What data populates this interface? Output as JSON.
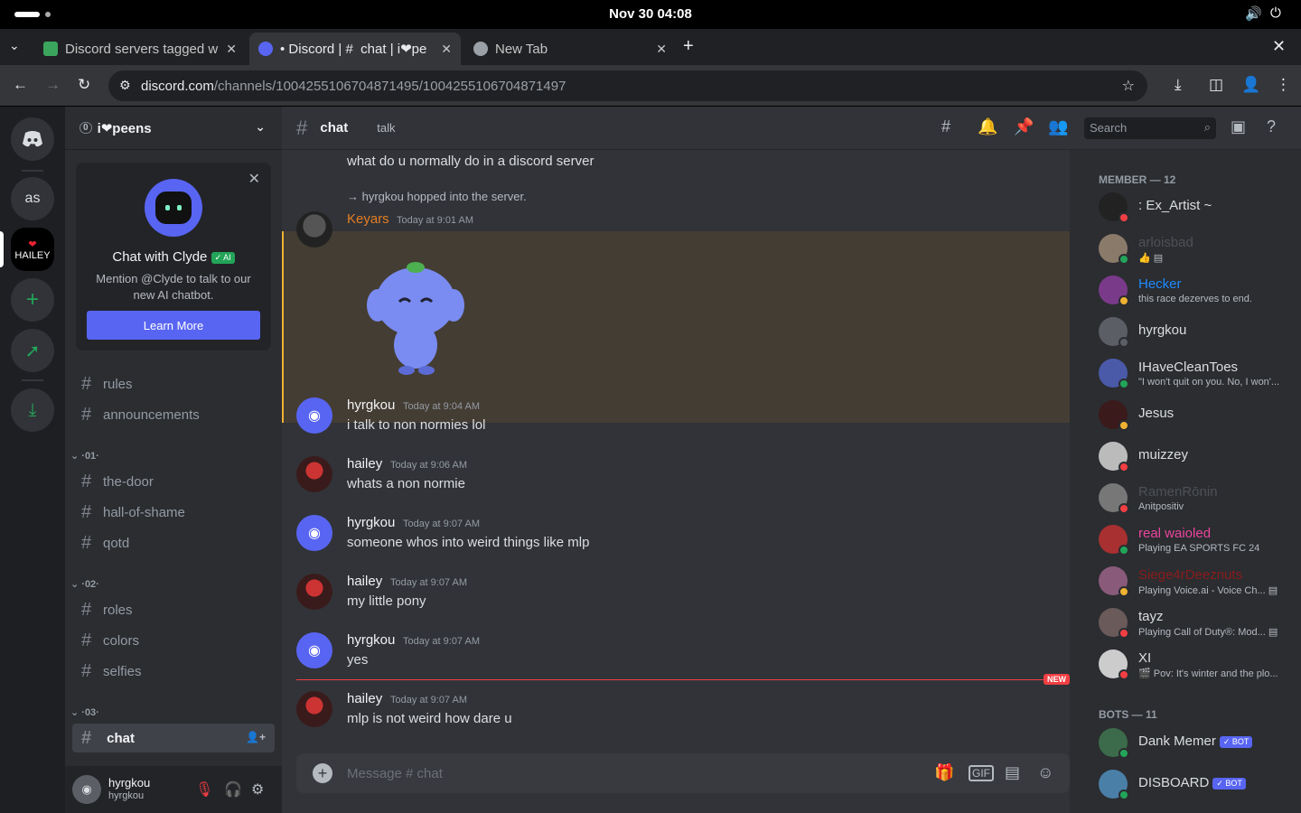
{
  "system": {
    "clock": "Nov 30  04:08"
  },
  "browser": {
    "tabs": [
      {
        "title": "Discord servers tagged w",
        "active": false
      },
      {
        "title": "• Discord | #  chat | i❤pe",
        "active": true
      },
      {
        "title": "New Tab",
        "active": false
      }
    ],
    "url_host": "discord.com",
    "url_path": "/channels/1004255106704871495/1004255106704871497"
  },
  "guilds": [
    {
      "label": "as"
    },
    {
      "label": "HAILEY"
    }
  ],
  "server": {
    "name": "i❤peens",
    "boost": "0"
  },
  "clyde": {
    "title": "Chat with Clyde",
    "ai_badge": "✓ AI",
    "description": "Mention @Clyde to talk to our new AI chatbot.",
    "button": "Learn More"
  },
  "channels": {
    "top": [
      {
        "name": "rules"
      },
      {
        "name": "announcements"
      }
    ],
    "cat1": "·01·",
    "group1": [
      {
        "name": "the-door"
      },
      {
        "name": "hall-of-shame"
      },
      {
        "name": "qotd"
      }
    ],
    "cat2": "·02·",
    "group2": [
      {
        "name": "roles"
      },
      {
        "name": "colors"
      },
      {
        "name": "selfies"
      }
    ],
    "cat3": "·03·",
    "group3": [
      {
        "name": " chat"
      }
    ]
  },
  "user": {
    "name": "hyrgkou",
    "tag": "hyrgkou"
  },
  "header": {
    "channel": " chat",
    "topic": "talk",
    "search": "Search"
  },
  "messages": {
    "prev": "what do u normally do in a discord server",
    "join": "→ hyrgkou hopped into the server.",
    "keyars": {
      "user": "Keyars",
      "time": "Today at 9:01 AM"
    },
    "m1": {
      "user": "hyrgkou",
      "time": "Today at 9:04 AM",
      "text": "i talk to non normies lol"
    },
    "m2": {
      "user": "hailey",
      "time": "Today at 9:06 AM",
      "text": "whats a non normie"
    },
    "m3": {
      "user": "hyrgkou",
      "time": "Today at 9:07 AM",
      "text": "someone whos into weird things like mlp"
    },
    "m4": {
      "user": "hailey",
      "time": "Today at 9:07 AM",
      "text": "my little pony"
    },
    "m5": {
      "user": "hyrgkou",
      "time": "Today at 9:07 AM",
      "text": "yes"
    },
    "m6": {
      "user": "hailey",
      "time": "Today at 9:07 AM",
      "text": "mlp is not weird how dare u"
    },
    "new_label": "NEW"
  },
  "composer": {
    "placeholder": "Message # chat"
  },
  "members": {
    "heading": "MEMBER — 12",
    "list": [
      {
        "name": ": Ex_Artist ~",
        "sub": "",
        "color": "#dbdee1"
      },
      {
        "name": "arloisbad",
        "sub": "👍 ▤",
        "color": "#4e5058"
      },
      {
        "name": "Hecker",
        "sub": "this race dezerves to end.",
        "color": "#1e8bff"
      },
      {
        "name": "hyrgkou",
        "sub": "",
        "color": "#dbdee1"
      },
      {
        "name": "IHaveCleanToes",
        "sub": "\"I won't quit on you. No, I won'...",
        "color": "#dbdee1"
      },
      {
        "name": "Jesus",
        "sub": "",
        "color": "#dbdee1"
      },
      {
        "name": "muizzey",
        "sub": "",
        "color": "#dbdee1"
      },
      {
        "name": "RamenRōnin",
        "sub": "Anitpositiv",
        "color": "#4e5058"
      },
      {
        "name": "real waioled",
        "sub": "Playing EA SPORTS FC 24",
        "color": "#eb459e"
      },
      {
        "name": "Siege4rDeeznuts",
        "sub": "Playing Voice.ai - Voice Ch... ▤",
        "color": "#8a1c1c"
      },
      {
        "name": "tayz",
        "sub": "Playing Call of Duty®: Mod... ▤",
        "color": "#dbdee1"
      },
      {
        "name": "XI",
        "sub": "🎬 Pov: It's winter and the plo...",
        "color": "#dbdee1"
      }
    ],
    "bots_heading": "BOTS — 11",
    "bots": [
      {
        "name": "Dank Memer",
        "badge": "✓ BOT"
      },
      {
        "name": "DISBOARD",
        "badge": "✓ BOT"
      }
    ]
  }
}
